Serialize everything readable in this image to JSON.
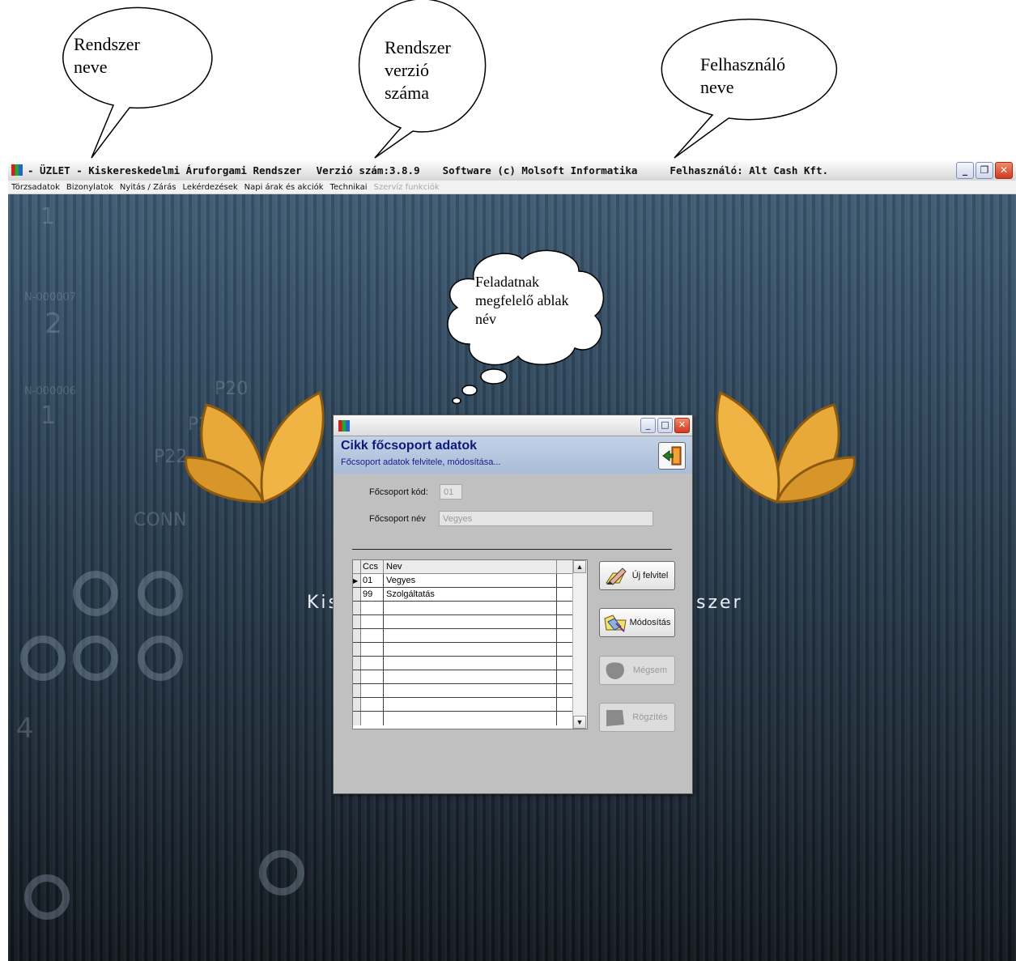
{
  "annotations": {
    "system_name": "Rendszer neve",
    "version": "Rendszer verzió száma",
    "user": "Felhasználó neve",
    "window_name": "Feladatnak megfelelő ablak név"
  },
  "titlebar": {
    "system": "- ÜZLET - Kiskereskedelmi Áruforgami Rendszer",
    "version": "Verzió szám:3.8.9",
    "software": "Software (c) Molsoft Informatika",
    "user": "Felhasználó: Alt Cash Kft."
  },
  "menu": [
    {
      "label": "Törzsadatok",
      "enabled": true
    },
    {
      "label": "Bizonylatok",
      "enabled": true
    },
    {
      "label": "Nyitás / Zárás",
      "enabled": true
    },
    {
      "label": "Lekérdezések",
      "enabled": true
    },
    {
      "label": "Napi árak és akciók",
      "enabled": true
    },
    {
      "label": "Technikai",
      "enabled": true
    },
    {
      "label": "Szervíz funkciók",
      "enabled": false
    }
  ],
  "background": {
    "banner_left": "Kis",
    "banner_right": "szer"
  },
  "dialog": {
    "heading": "Cikk főcsoport adatok",
    "subtitle": "Főcsoport adatok felvitele, módosítása...",
    "fields": {
      "code_label": "Főcsoport kód:",
      "code_value": "01",
      "name_label": "Főcsoport név",
      "name_value": "Vegyes"
    },
    "table": {
      "columns": [
        "Ccs",
        "Nev"
      ],
      "rows": [
        {
          "ccs": "01",
          "nev": "Vegyes",
          "current": true
        },
        {
          "ccs": "99",
          "nev": "Szolgáltatás",
          "current": false
        }
      ]
    },
    "buttons": {
      "new": "Új felvitel",
      "modify": "Módosítás",
      "cancel": "Mégsem",
      "save": "Rögzítés"
    }
  }
}
